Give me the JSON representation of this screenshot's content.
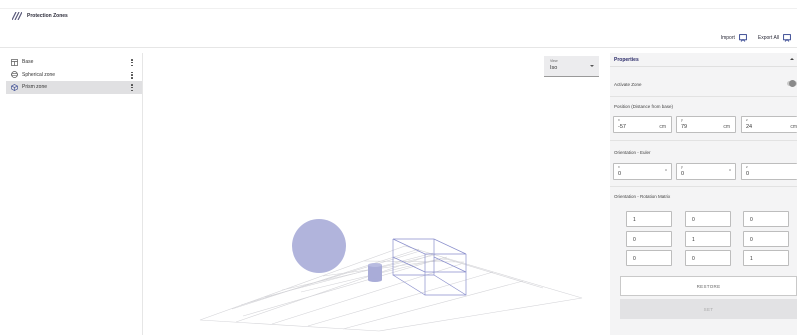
{
  "app": {
    "title": "Protection Zones"
  },
  "top_actions": {
    "import_label": "Import",
    "export_label": "Export All"
  },
  "sidebar": {
    "items": [
      {
        "label": "Base",
        "icon": "base-icon",
        "active": false
      },
      {
        "label": "Spherical zone",
        "icon": "sphere-icon",
        "active": false
      },
      {
        "label": "Prism zone",
        "icon": "prism-icon",
        "active": true
      }
    ]
  },
  "viewport": {
    "view_label": "View",
    "view_value": "Iso",
    "sphere_color": "#a9acd8",
    "cylinder_color": "#a9acd8",
    "prism_color": "#8a8fcc",
    "grid_color": "#d4d4d8"
  },
  "properties": {
    "title": "Properties",
    "activate_label": "Activate Zone",
    "position_label": "Position (Distance from base)",
    "position": [
      {
        "axis": "x",
        "value": "-57",
        "unit": "cm"
      },
      {
        "axis": "y",
        "value": "79",
        "unit": "cm"
      },
      {
        "axis": "z",
        "value": "24",
        "unit": "cm"
      }
    ],
    "euler_label": "Orientation - Euler",
    "euler": [
      {
        "axis": "x",
        "value": "0",
        "unit": "°"
      },
      {
        "axis": "y",
        "value": "0",
        "unit": "°"
      },
      {
        "axis": "z",
        "value": "0",
        "unit": ""
      }
    ],
    "matrix_label": "Orientation - Rotation Matrix",
    "matrix": [
      [
        "1",
        "0",
        "0"
      ],
      [
        "0",
        "1",
        "0"
      ],
      [
        "0",
        "0",
        "1"
      ]
    ],
    "restore_label": "RESTORE",
    "set_label": "SET"
  }
}
